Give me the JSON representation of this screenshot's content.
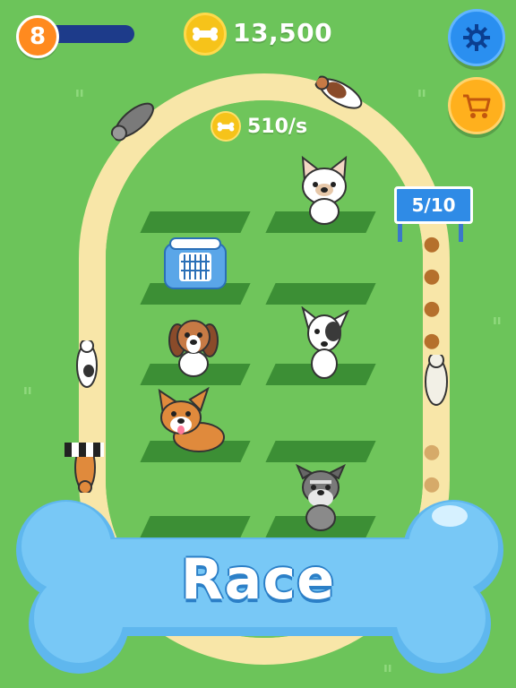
{
  "hud": {
    "level": "8",
    "xp_progress": 0.12,
    "coins": "13,500",
    "rate": "510/s"
  },
  "race_status": {
    "progress_sign": "5/10"
  },
  "race_button": {
    "label": "Race"
  },
  "icons": {
    "coin": "bone-coin-icon",
    "settings": "gear-icon",
    "shop": "shopping-cart-icon",
    "crate": "pet-carrier-icon"
  },
  "colors": {
    "background": "#6cc45a",
    "track": "#f8e6a8",
    "bone": "#6fc3f5",
    "coin": "#f6c31a",
    "settings": "#2a8ff0",
    "shop": "#ffb01d"
  }
}
